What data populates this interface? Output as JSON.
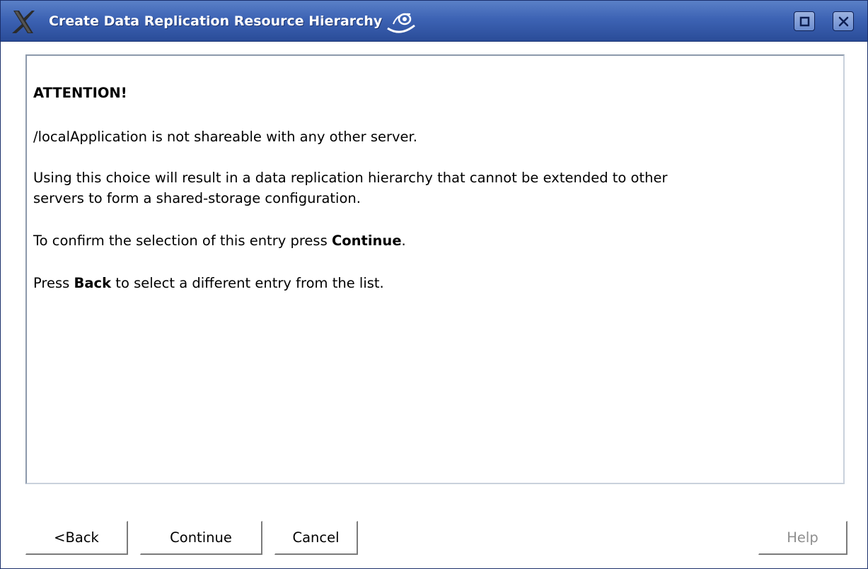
{
  "window": {
    "title": "Create Data Replication Resource Hierarchy",
    "controls": {
      "maximize_icon": "maximize-icon",
      "close_icon": "close-icon"
    },
    "colors": {
      "titlebar": "#3d63b4",
      "title_text": "#ffffff"
    }
  },
  "message": {
    "heading": "ATTENTION!",
    "line1": "/localApplication is not shareable with any other server.",
    "line2_a": "Using this choice will result in a data replication hierarchy that cannot be extended to other",
    "line2_b": "servers to form a shared-storage configuration.",
    "line3_pre": "To confirm the selection of this entry press ",
    "line3_bold": "Continue",
    "line3_post": ".",
    "line4_pre": "Press ",
    "line4_bold": "Back",
    "line4_post": " to select a different entry from the list."
  },
  "buttons": {
    "back": "<Back",
    "continue": "Continue",
    "cancel": "Cancel",
    "help": "Help",
    "help_disabled_color": "#8e8e8e"
  }
}
